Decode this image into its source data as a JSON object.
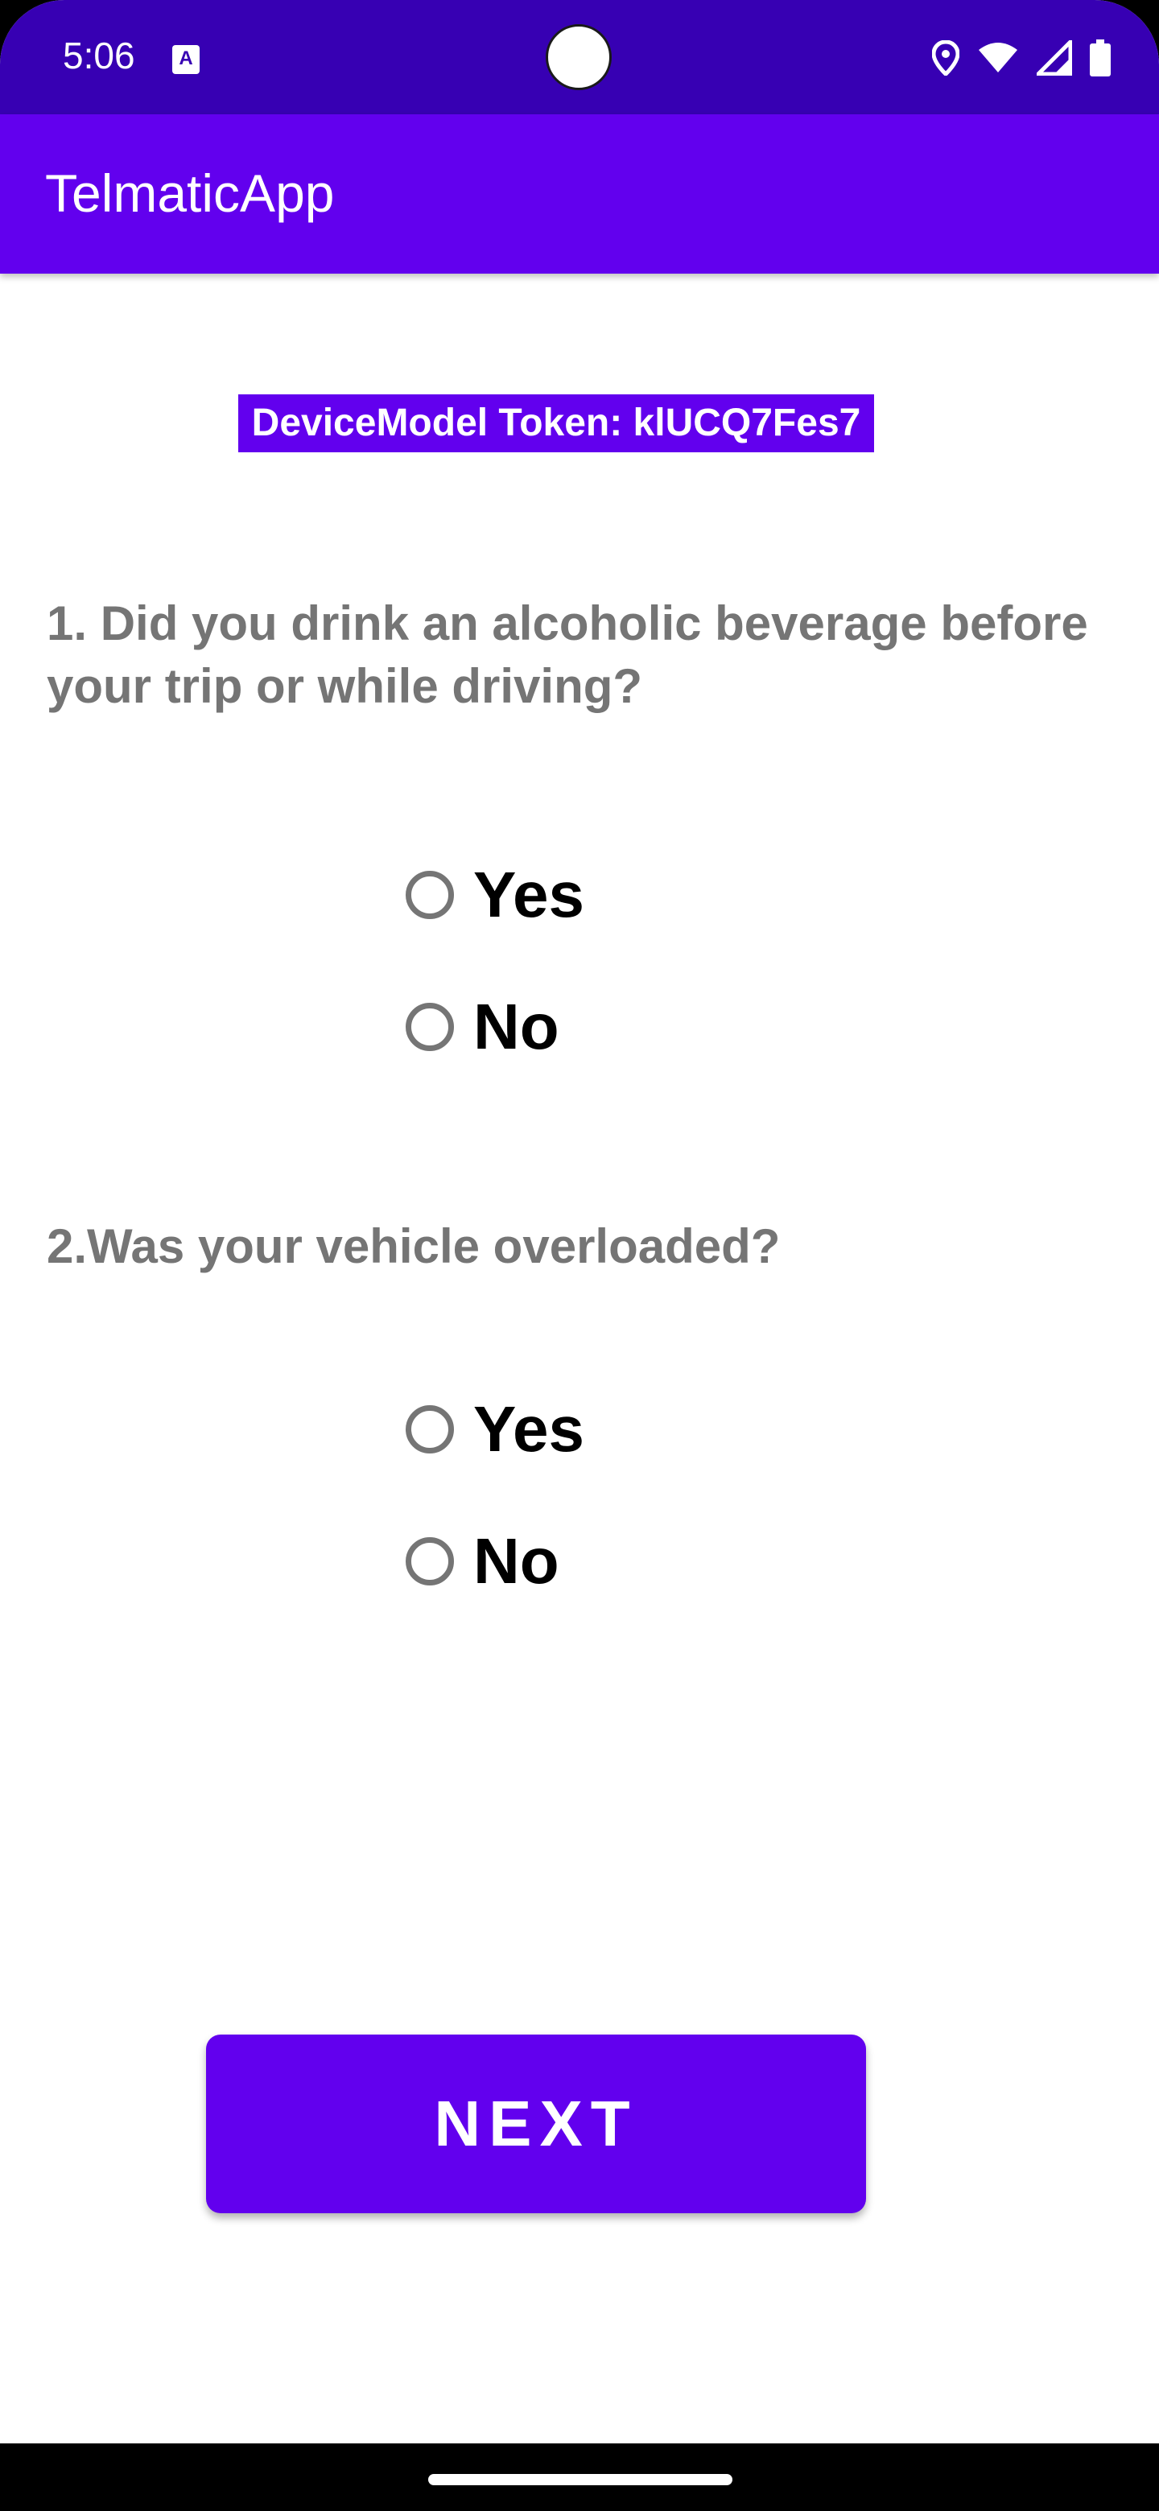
{
  "status_bar": {
    "time": "5:06",
    "notification_icon": "accessibility-text-icon",
    "icons": [
      "location-icon",
      "wifi-icon",
      "signal-icon",
      "battery-icon"
    ]
  },
  "app_bar": {
    "title": "TelmaticApp"
  },
  "token": {
    "text": "DeviceModel Token: klUCQ7Fes7"
  },
  "questions": [
    {
      "text": "1. Did you drink an alcoholic beverage before your trip or while driving?",
      "options": [
        "Yes",
        "No"
      ]
    },
    {
      "text": "2.Was your vehicle overloaded?",
      "options": [
        "Yes",
        "No"
      ]
    }
  ],
  "next_button": {
    "label": "NEXT"
  },
  "colors": {
    "status_bar": "#3700b3",
    "primary": "#6200ee",
    "question_text": "#757575",
    "radio_border": "#757575"
  }
}
